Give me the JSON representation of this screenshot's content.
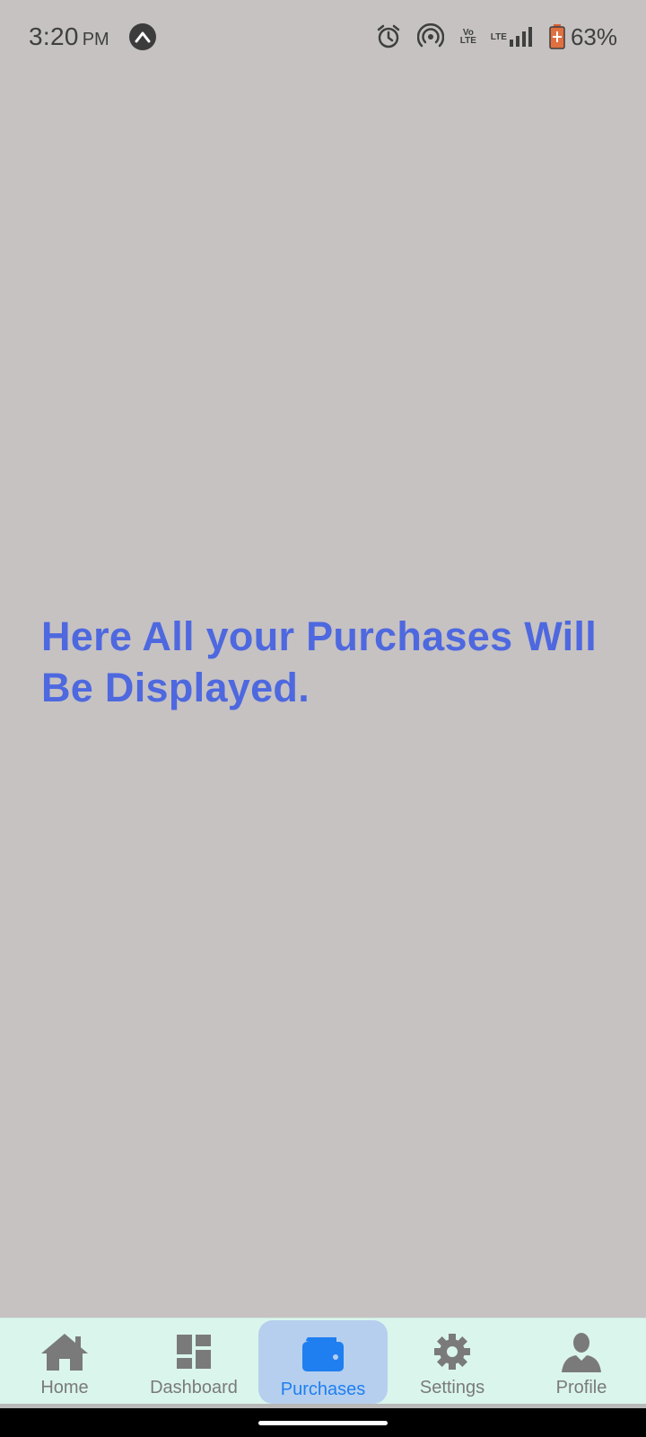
{
  "status_bar": {
    "time": "3:20",
    "ampm": "PM",
    "battery_percent": "63%",
    "network_tag_1": "Vo LTE",
    "network_tag_2": "LTE",
    "icons": [
      "app-notification-icon",
      "alarm-icon",
      "hotspot-icon",
      "signal-icon",
      "battery-icon"
    ]
  },
  "main": {
    "message": "Here All your Purchases Will Be Displayed."
  },
  "bottom_nav": {
    "active_tab": "Purchases",
    "active_color": "#1f7ff0",
    "inactive_color": "#7a7a7a",
    "items": [
      {
        "label": "Home",
        "icon": "home-icon"
      },
      {
        "label": "Dashboard",
        "icon": "dashboard-icon"
      },
      {
        "label": "Purchases",
        "icon": "wallet-icon"
      },
      {
        "label": "Settings",
        "icon": "gear-icon"
      },
      {
        "label": "Profile",
        "icon": "person-icon"
      }
    ]
  }
}
